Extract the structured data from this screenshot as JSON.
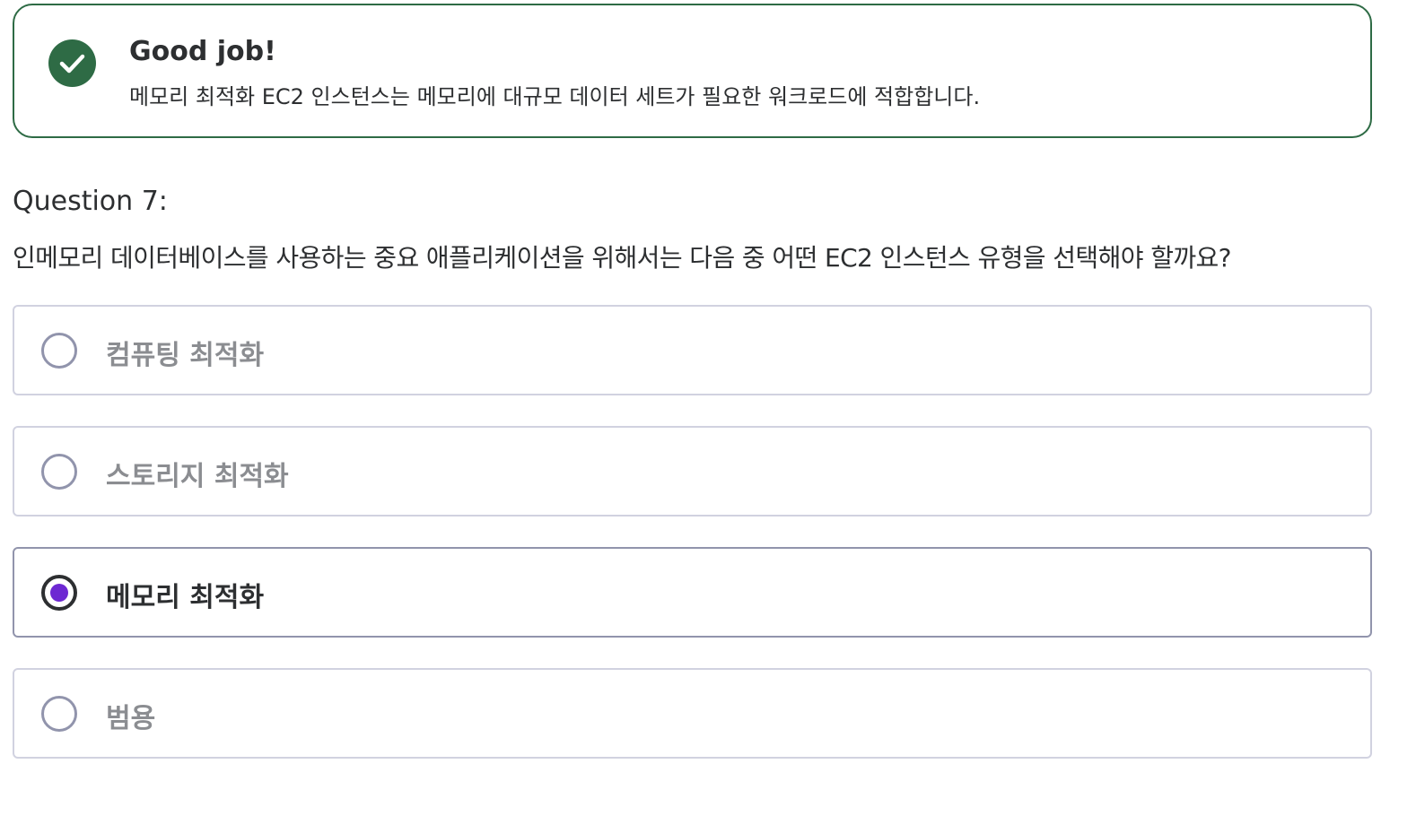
{
  "feedback": {
    "status_icon": "check-icon",
    "accent_color": "#2e6b45",
    "title": "Good job!",
    "message": "메모리 최적화 EC2 인스턴스는 메모리에 대규모 데이터 세트가 필요한 워크로드에 적합합니다."
  },
  "question": {
    "label": "Question 7:",
    "text": "인메모리 데이터베이스를 사용하는 중요 애플리케이션을 위해서는 다음 중 어떤 EC2 인스턴스 유형을 선택해야 할까요?"
  },
  "options": [
    {
      "label": "컴퓨팅 최적화",
      "selected": false
    },
    {
      "label": "스토리지 최적화",
      "selected": false
    },
    {
      "label": "메모리 최적화",
      "selected": true
    },
    {
      "label": "범용",
      "selected": false
    }
  ],
  "colors": {
    "selected_radio": "#6d28d2",
    "text": "#2d2f31",
    "muted_text": "#8b8d91"
  }
}
